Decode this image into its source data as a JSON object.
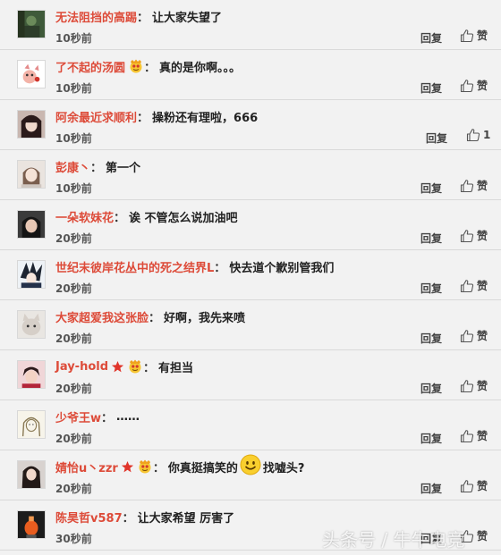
{
  "comments": [
    {
      "user": "无法阻挡的高踢",
      "badges": [],
      "text": "让大家失望了",
      "time": "10秒前",
      "reply": "回复",
      "like": "赞",
      "avatar": "green"
    },
    {
      "user": "了不起的汤圆",
      "badges": [
        "vip-emoji"
      ],
      "text": "真的是你啊。。。",
      "time": "10秒前",
      "reply": "回复",
      "like": "赞",
      "avatar": "cartoon"
    },
    {
      "user": "阿余最近求顺利",
      "badges": [],
      "text": "操粉还有理啦，666",
      "time": "10秒前",
      "reply": "回复",
      "like": "1",
      "avatar": "dark-hair"
    },
    {
      "user": "彭康丶",
      "badges": [],
      "text": "第一个",
      "time": "10秒前",
      "reply": "回复",
      "like": "赞",
      "avatar": "girl-light"
    },
    {
      "user": "一朵软妹花",
      "badges": [],
      "text": "诶  不管怎么说加油吧",
      "time": "20秒前",
      "reply": "回复",
      "like": "赞",
      "avatar": "girl-dark"
    },
    {
      "user": "世纪末彼岸花丛中的死之结界L",
      "badges": [],
      "text": "快去道个歉别管我们",
      "time": "20秒前",
      "reply": "回复",
      "like": "赞",
      "avatar": "anime"
    },
    {
      "user": "大家超爱我这张脸",
      "badges": [],
      "text": "好啊，我先来喷",
      "time": "20秒前",
      "reply": "回复",
      "like": "赞",
      "avatar": "cat"
    },
    {
      "user": "Jay-hold",
      "badges": [
        "star",
        "vip-emoji"
      ],
      "text": "有担当",
      "time": "20秒前",
      "reply": "回复",
      "like": "赞",
      "avatar": "boy-red"
    },
    {
      "user": "少爷王w",
      "badges": [],
      "text": "……",
      "time": "20秒前",
      "reply": "回复",
      "like": "赞",
      "avatar": "sketch"
    },
    {
      "user": "婧怡u丶zzr",
      "badges": [
        "star",
        "vip-emoji"
      ],
      "text": "你真挺搞笑的",
      "text_after": "找嘘头?",
      "emoji": "smile-emoji",
      "time": "20秒前",
      "reply": "回复",
      "like": "赞",
      "avatar": "girl-long"
    },
    {
      "user": "陈昊哲v587",
      "badges": [],
      "text": "让大家希望 厉害了",
      "time": "30秒前",
      "reply": "回复",
      "like": "赞",
      "avatar": "orange"
    }
  ],
  "watermark": "头条号 / 牛牛电竞",
  "colors": {
    "username": "#dd4b39",
    "background": "#f2f2f2",
    "divider": "#d9d9d9"
  }
}
